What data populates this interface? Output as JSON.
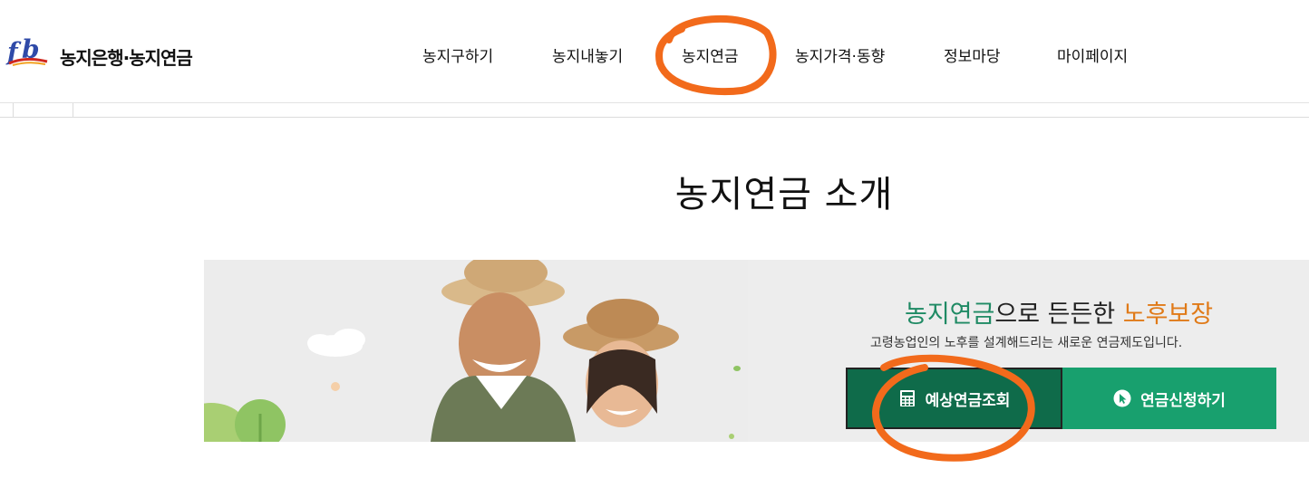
{
  "header": {
    "logo_text": "농지은행·농지연금",
    "logo_icon": "fb-logo-icon"
  },
  "nav": {
    "items": [
      {
        "label": "농지구하기"
      },
      {
        "label": "농지내놓기"
      },
      {
        "label": "농지연금"
      },
      {
        "label": "농지가격·동향"
      },
      {
        "label": "정보마당"
      },
      {
        "label": "마이페이지"
      }
    ]
  },
  "main": {
    "title": "농지연금 소개"
  },
  "banner": {
    "headline_part1": "농지연금",
    "headline_part2": "으로 든든한 ",
    "headline_part3": "노후보장",
    "subtitle": "고령농업인의 노후를 설계해드리는 새로운 연금제도입니다.",
    "estimate_button": "예상연금조회",
    "estimate_icon": "calculator-icon",
    "apply_button": "연금신청하기",
    "apply_icon": "cursor-icon"
  },
  "colors": {
    "green_dark": "#0f6b4a",
    "green_light": "#18a06e",
    "headline_green": "#1f8a64",
    "headline_orange": "#e07a18",
    "annotation": "#f26a1b"
  }
}
